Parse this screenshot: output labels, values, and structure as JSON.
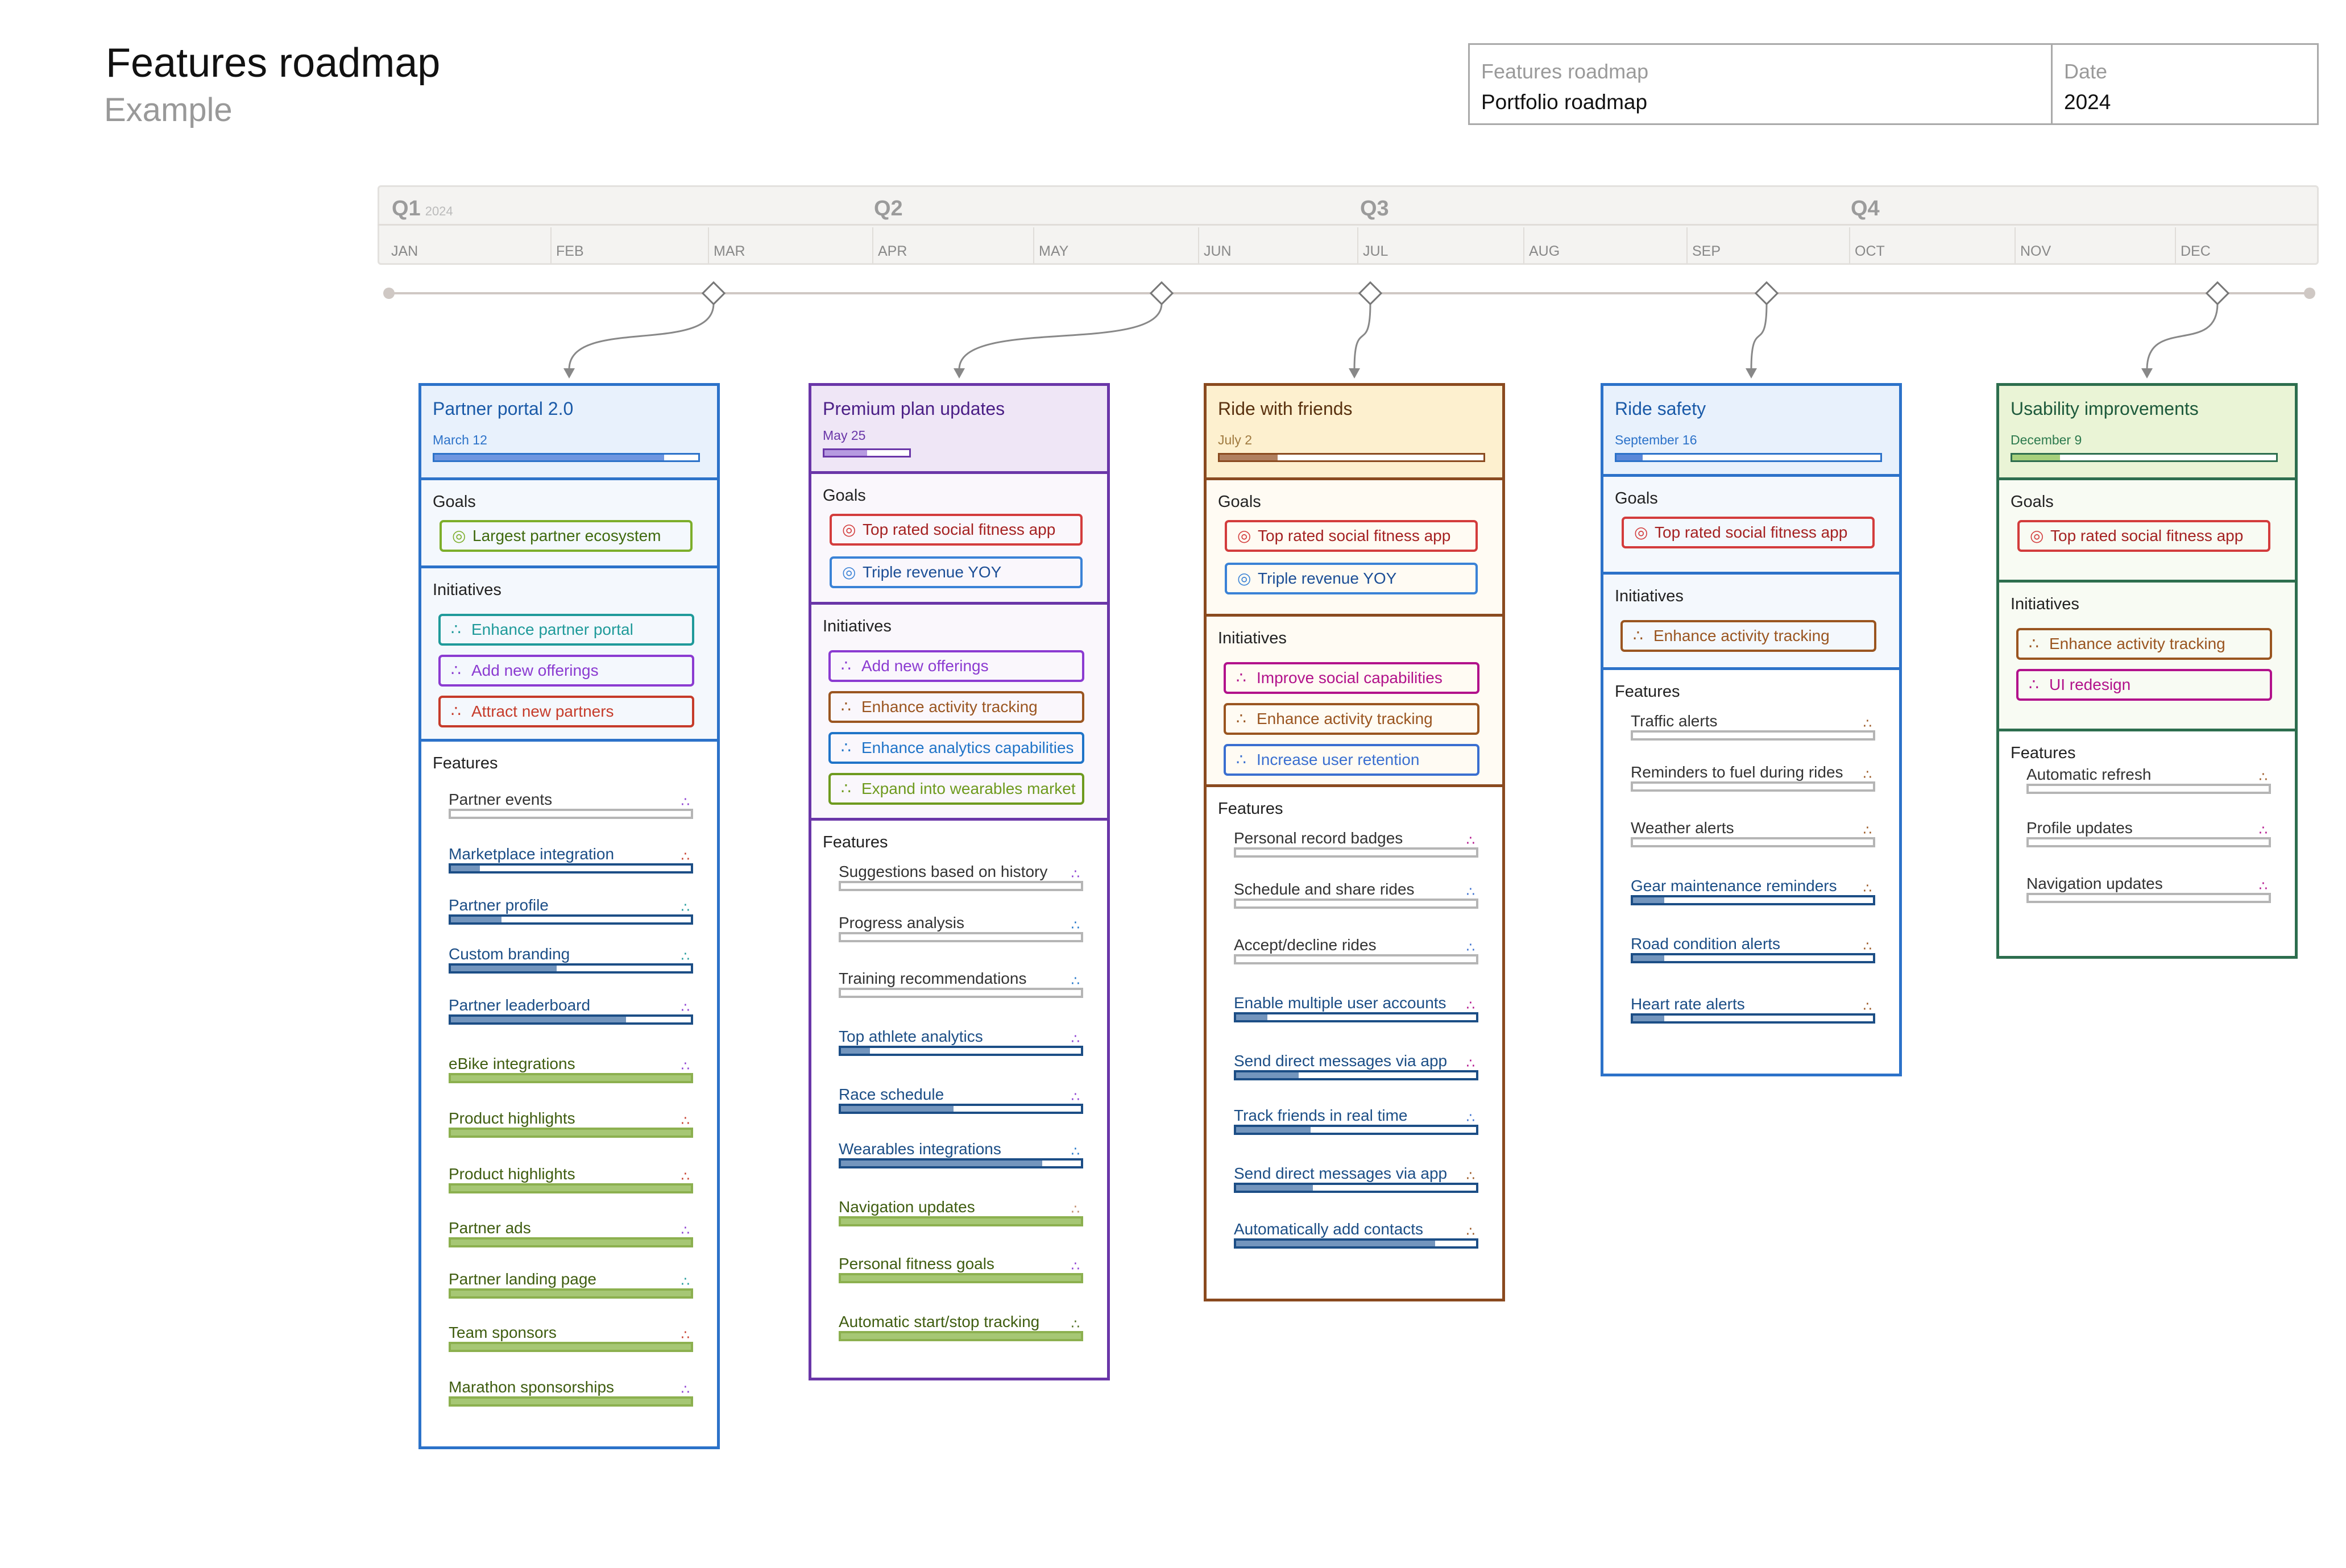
{
  "header": {
    "title": "Features roadmap",
    "subtitle": "Example"
  },
  "infobox": {
    "label1": "Features roadmap",
    "value1": "Portfolio roadmap",
    "label2": "Date",
    "value2": "2024"
  },
  "timeline": {
    "year": "2024",
    "quarters": [
      "Q1",
      "Q2",
      "Q3",
      "Q4"
    ],
    "months": [
      "JAN",
      "FEB",
      "MAR",
      "APR",
      "MAY",
      "JUN",
      "JUL",
      "AUG",
      "SEP",
      "OCT",
      "NOV",
      "DEC"
    ]
  },
  "section_labels": {
    "goals": "Goals",
    "initiatives": "Initiatives",
    "features": "Features"
  },
  "colors": {
    "feature_gray": "#9e9e9e",
    "feature_blue": "#1c4e86",
    "feature_blue_fill": "#7395bd",
    "feature_green": "#8cb04f",
    "feature_green_fill": "#a6c774",
    "goal_red": "#d33c3c",
    "goal_blue": "#3a82d6",
    "goal_green": "#7cae2a"
  },
  "cards": [
    {
      "title": "Partner portal 2.0",
      "date": "March 12",
      "progress": 0.87,
      "goals": [
        {
          "label": "Largest partner ecosystem",
          "color": "goal_green",
          "icon": "target-icon"
        }
      ],
      "initiatives": [
        {
          "label": "Enhance partner portal",
          "color": "#1f9a9a",
          "icon": "initiative-icon"
        },
        {
          "label": "Add new offerings",
          "color": "#8b3bd1",
          "icon": "initiative-icon"
        },
        {
          "label": "Attract new partners",
          "color": "#c63b2a",
          "icon": "initiative-icon"
        }
      ],
      "features": [
        {
          "name": "Partner events",
          "status": "gray",
          "progress": 0,
          "icon_color": "#8b3bd1"
        },
        {
          "name": "Marketplace integration",
          "status": "blue",
          "progress": 0.12,
          "icon_color": "#c63b2a"
        },
        {
          "name": "Partner profile",
          "status": "blue",
          "progress": 0.21,
          "icon_color": "#1f9a9a"
        },
        {
          "name": "Custom branding",
          "status": "blue",
          "progress": 0.44,
          "icon_color": "#1f9a9a"
        },
        {
          "name": "Partner leaderboard",
          "status": "blue",
          "progress": 0.73,
          "icon_color": "#8b3bd1"
        },
        {
          "name": "eBike integrations",
          "status": "green",
          "progress": 1,
          "icon_color": "#8b3bd1"
        },
        {
          "name": "Product highlights",
          "status": "green",
          "progress": 1,
          "icon_color": "#c63b2a"
        },
        {
          "name": "Product highlights",
          "status": "green",
          "progress": 1,
          "icon_color": "#c63b2a"
        },
        {
          "name": "Partner ads",
          "status": "green",
          "progress": 1,
          "icon_color": "#8b3bd1"
        },
        {
          "name": "Partner landing page",
          "status": "green",
          "progress": 1,
          "icon_color": "#1f9a9a"
        },
        {
          "name": "Team sponsors",
          "status": "green",
          "progress": 1,
          "icon_color": "#c63b2a"
        },
        {
          "name": "Marathon sponsorships",
          "status": "green",
          "progress": 1,
          "icon_color": "#8b3bd1"
        }
      ]
    },
    {
      "title": "Premium plan updates",
      "date": "May 25",
      "progress": 0.5,
      "goals": [
        {
          "label": "Top rated social fitness app",
          "color": "goal_red",
          "icon": "target-icon"
        },
        {
          "label": "Triple revenue YOY",
          "color": "goal_blue",
          "icon": "target-icon"
        }
      ],
      "initiatives": [
        {
          "label": "Add new offerings",
          "color": "#8b3bd1",
          "icon": "initiative-icon"
        },
        {
          "label": "Enhance activity tracking",
          "color": "#9a5520",
          "icon": "initiative-icon"
        },
        {
          "label": "Enhance analytics capabilities",
          "color": "#1f74c8",
          "icon": "initiative-icon"
        },
        {
          "label": "Expand into wearables market",
          "color": "#6e9a1e",
          "icon": "initiative-icon"
        }
      ],
      "features": [
        {
          "name": "Suggestions based on history",
          "status": "gray",
          "progress": 0,
          "icon_color": "#8b3bd1"
        },
        {
          "name": "Progress analysis",
          "status": "gray",
          "progress": 0,
          "icon_color": "#1f74c8"
        },
        {
          "name": "Training recommendations",
          "status": "gray",
          "progress": 0,
          "icon_color": "#1f74c8"
        },
        {
          "name": "Top athlete analytics",
          "status": "blue",
          "progress": 0.12,
          "icon_color": "#8b3bd1"
        },
        {
          "name": "Race schedule",
          "status": "blue",
          "progress": 0.47,
          "icon_color": "#8b3bd1"
        },
        {
          "name": "Wearables integrations",
          "status": "blue",
          "progress": 0.84,
          "icon_color": "#1f74c8"
        },
        {
          "name": "Navigation updates",
          "status": "green",
          "progress": 1,
          "icon_color": "#c08a6a"
        },
        {
          "name": "Personal fitness goals",
          "status": "green",
          "progress": 1,
          "icon_color": "#8b3bd1"
        },
        {
          "name": "Automatic start/stop tracking",
          "status": "green",
          "progress": 1,
          "icon_color": "#4a6a1a"
        }
      ]
    },
    {
      "title": "Ride with friends",
      "date": "July 2",
      "progress": 0.22,
      "goals": [
        {
          "label": "Top rated social fitness app",
          "color": "goal_red",
          "icon": "target-icon"
        },
        {
          "label": "Triple revenue YOY",
          "color": "goal_blue",
          "icon": "target-icon"
        }
      ],
      "initiatives": [
        {
          "label": "Improve social capabilities",
          "color": "#b2128b",
          "icon": "initiative-icon"
        },
        {
          "label": "Enhance activity tracking",
          "color": "#9a5520",
          "icon": "initiative-icon"
        },
        {
          "label": "Increase user retention",
          "color": "#3a6fd0",
          "icon": "initiative-icon"
        }
      ],
      "features": [
        {
          "name": "Personal record badges",
          "status": "gray",
          "progress": 0,
          "icon_color": "#b2128b"
        },
        {
          "name": "Schedule and share rides",
          "status": "gray",
          "progress": 0,
          "icon_color": "#3a6fd0"
        },
        {
          "name": "Accept/decline rides",
          "status": "gray",
          "progress": 0,
          "icon_color": "#3a6fd0"
        },
        {
          "name": "Enable multiple user accounts",
          "status": "blue",
          "progress": 0.13,
          "icon_color": "#b2128b"
        },
        {
          "name": "Send direct messages via app",
          "status": "blue",
          "progress": 0.26,
          "icon_color": "#b2128b"
        },
        {
          "name": "Track friends in real time",
          "status": "blue",
          "progress": 0.31,
          "icon_color": "#3a6fd0"
        },
        {
          "name": "Send direct messages via app",
          "status": "blue",
          "progress": 0.32,
          "icon_color": "#9a5520"
        },
        {
          "name": "Automatically add contacts",
          "status": "blue",
          "progress": 0.83,
          "icon_color": "#9a5520"
        }
      ]
    },
    {
      "title": "Ride safety",
      "date": "September 16",
      "progress": 0.1,
      "goals": [
        {
          "label": "Top rated social fitness app",
          "color": "goal_red",
          "icon": "target-icon"
        }
      ],
      "initiatives": [
        {
          "label": "Enhance activity tracking",
          "color": "#9a5520",
          "icon": "initiative-icon"
        }
      ],
      "features": [
        {
          "name": "Traffic alerts",
          "status": "gray",
          "progress": 0,
          "icon_color": "#9a5520"
        },
        {
          "name": "Reminders to fuel during rides",
          "status": "gray",
          "progress": 0,
          "icon_color": "#9a5520"
        },
        {
          "name": "Weather alerts",
          "status": "gray",
          "progress": 0,
          "icon_color": "#9a5520"
        },
        {
          "name": "Gear maintenance reminders",
          "status": "blue",
          "progress": 0.13,
          "icon_color": "#9a5520"
        },
        {
          "name": "Road condition alerts",
          "status": "blue",
          "progress": 0.13,
          "icon_color": "#9a5520"
        },
        {
          "name": "Heart rate alerts",
          "status": "blue",
          "progress": 0.13,
          "icon_color": "#9a5520"
        }
      ]
    },
    {
      "title": "Usability improvements",
      "date": "December 9",
      "progress": 0.18,
      "goals": [
        {
          "label": "Top rated social fitness app",
          "color": "goal_red",
          "icon": "target-icon"
        }
      ],
      "initiatives": [
        {
          "label": "Enhance activity tracking",
          "color": "#9a5520",
          "icon": "initiative-icon"
        },
        {
          "label": "UI redesign",
          "color": "#b2128b",
          "icon": "initiative-icon"
        }
      ],
      "features": [
        {
          "name": "Automatic refresh",
          "status": "gray",
          "progress": 0,
          "icon_color": "#9a5520"
        },
        {
          "name": "Profile updates",
          "status": "gray",
          "progress": 0,
          "icon_color": "#b2128b"
        },
        {
          "name": "Navigation updates",
          "status": "gray",
          "progress": 0,
          "icon_color": "#b2128b"
        }
      ]
    }
  ]
}
